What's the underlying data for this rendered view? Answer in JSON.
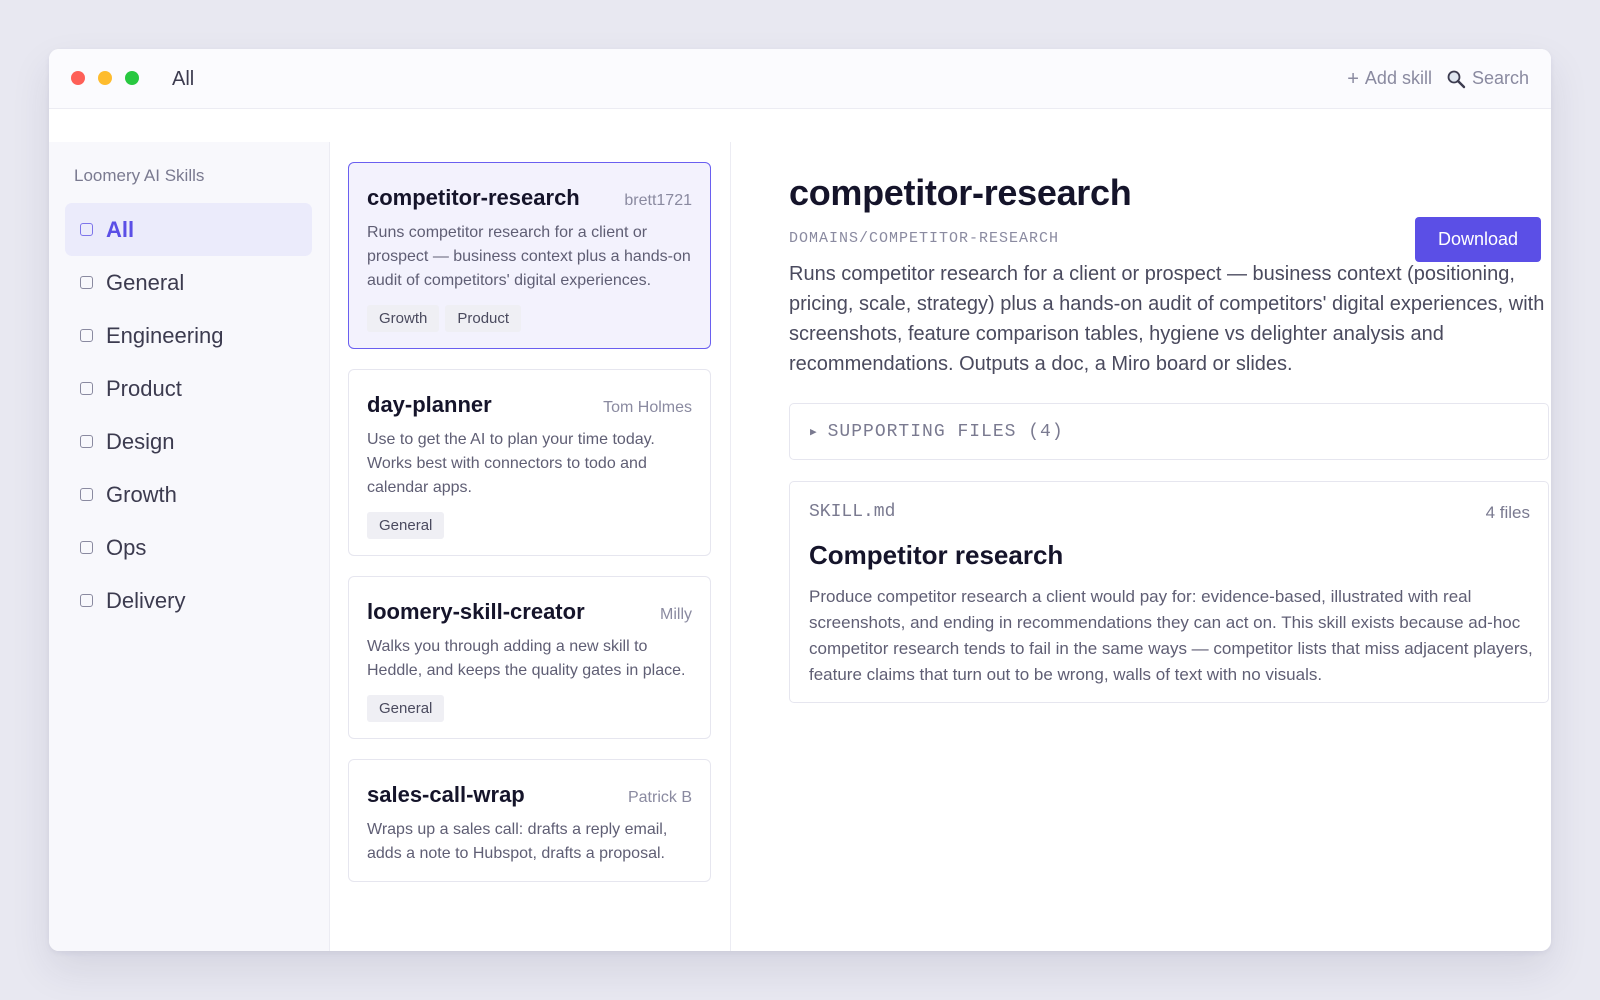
{
  "window": {
    "title": "All"
  },
  "toolbar": {
    "add_skill_label": "Add skill",
    "search_label": "Search"
  },
  "sidebar": {
    "brand": "Loomery AI Skills",
    "items": [
      {
        "label": "All",
        "active": true
      },
      {
        "label": "General"
      },
      {
        "label": "Engineering"
      },
      {
        "label": "Product"
      },
      {
        "label": "Design"
      },
      {
        "label": "Growth"
      },
      {
        "label": "Ops"
      },
      {
        "label": "Delivery"
      }
    ]
  },
  "skills": [
    {
      "name": "competitor-research",
      "author": "brett1721",
      "description": "Runs competitor research for a client or prospect — business context plus a hands-on audit of competitors' digital experiences.",
      "tags": [
        "Growth",
        "Product"
      ]
    },
    {
      "name": "day-planner",
      "author": "Tom Holmes",
      "description": "Use to get the AI to plan your time today. Works best with connectors to todo and calendar apps.",
      "tags": [
        "General"
      ]
    },
    {
      "name": "loomery-skill-creator",
      "author": "Milly",
      "description": "Walks you through adding a new skill to Heddle, and keeps the quality gates in place.",
      "tags": [
        "General"
      ]
    },
    {
      "name": "sales-call-wrap",
      "author": "Patrick B",
      "description": "Wraps up a sales call: drafts a reply email, adds a note to Hubspot, drafts a proposal.",
      "tags": []
    }
  ],
  "detail": {
    "title": "competitor-research",
    "download_label": "Download",
    "path": "DOMAINS/COMPETITOR-RESEARCH",
    "description": "Runs competitor research for a client or prospect — business context (positioning, pricing, scale, strategy) plus a hands-on audit of competitors' digital experiences, with screenshots, feature comparison tables, hygiene vs delighter analysis and recommendations. Outputs a doc, a Miro board or slides.",
    "supporting_files_label": "SUPPORTING FILES (4)",
    "skill_file": {
      "filename": "SKILL.md",
      "file_count": "4 files",
      "heading": "Competitor research",
      "body": "Produce competitor research a client would pay for: evidence-based, illustrated with real screenshots, and ending in recommendations they can act on. This skill exists because ad-hoc competitor research tends to fail in the same ways — competitor lists that miss adjacent players, feature claims that turn out to be wrong, walls of text with no visuals."
    }
  },
  "colors": {
    "accent": "#5b4fe6",
    "selected_bg": "#f3f2fd"
  }
}
